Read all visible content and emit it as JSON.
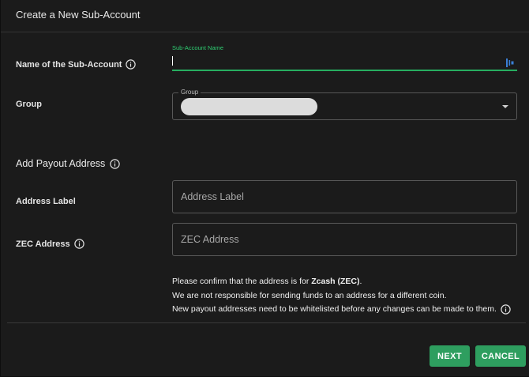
{
  "dialog": {
    "title": "Create a New Sub-Account"
  },
  "sub_account": {
    "row_label": "Name of the Sub-Account",
    "floating_label": "Sub-Account Name",
    "value": ""
  },
  "group": {
    "row_label": "Group",
    "legend": "Group"
  },
  "payout": {
    "section_title": "Add Payout Address",
    "address_label": {
      "row_label": "Address Label",
      "placeholder": "Address Label"
    },
    "zec_address": {
      "row_label": "ZEC Address",
      "placeholder": "ZEC Address"
    }
  },
  "notice": {
    "line1_prefix": "Please confirm that the address is for ",
    "line1_coin": "Zcash (ZEC)",
    "line1_suffix": ".",
    "line2": "We are not responsible for sending funds to an address for a different coin.",
    "line3": "New payout addresses need to be whitelisted before any changes can be made to them."
  },
  "buttons": {
    "next": "NEXT",
    "cancel": "CANCEL"
  },
  "colors": {
    "accent": "#2e9e5f",
    "focus_green": "#2ecc71",
    "background": "#1b1b1b"
  },
  "icons": {
    "info": "info-circle-icon",
    "password_manager": "password-manager-icon",
    "dropdown": "chevron-down-icon"
  }
}
